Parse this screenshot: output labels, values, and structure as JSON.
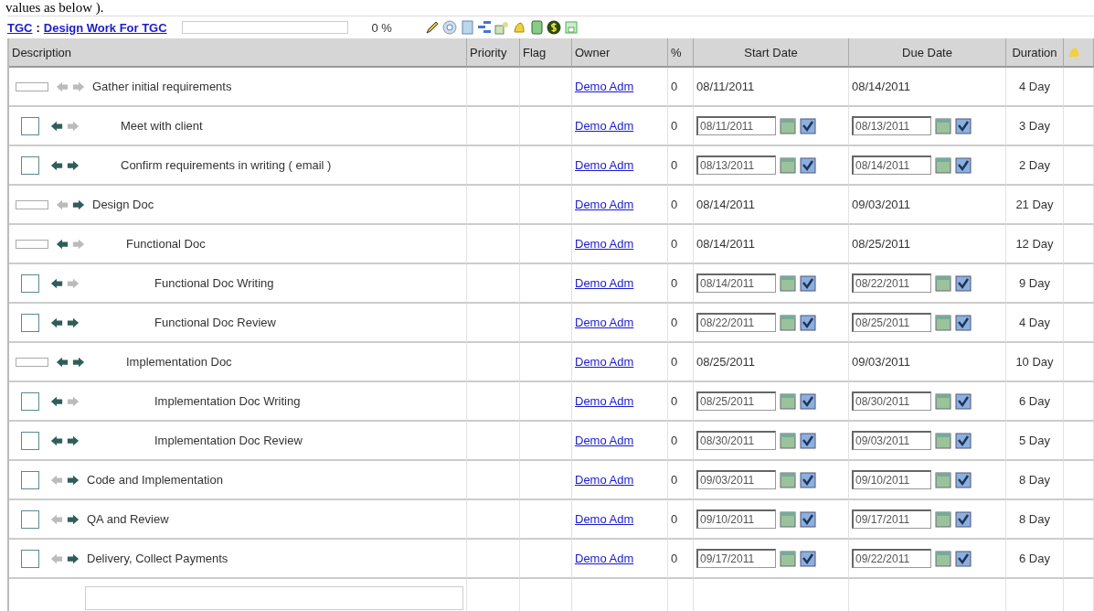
{
  "intro_text": "values as below ).",
  "header": {
    "project_link": "TGC",
    "separator": ":",
    "title_link": "Design Work For TGC",
    "progress": {
      "level": 0
    },
    "percent": "0 %"
  },
  "columns": [
    "Description",
    "Priority",
    "Flag",
    "Owner",
    "%",
    "Start Date",
    "Due Date",
    "Duration"
  ],
  "tasks": [
    {
      "kind": "summary",
      "name": "Gather initial requirements",
      "left_enabled": false,
      "right_enabled": false,
      "owner": "Demo Adm",
      "percent": "0",
      "start": "08/11/2011",
      "due": "08/14/2011",
      "duration": "4 Day",
      "children": [
        {
          "kind": "task",
          "name": "Meet with client",
          "checked": false,
          "left_enabled": true,
          "right_enabled": false,
          "owner": "Demo Adm",
          "percent": "0",
          "start": "08/11/2011",
          "due": "08/13/2011",
          "duration": "3 Day"
        },
        {
          "kind": "task",
          "name": "Confirm requirements in writing ( email )",
          "checked": false,
          "left_enabled": true,
          "right_enabled": true,
          "owner": "Demo Adm",
          "percent": "0",
          "start": "08/13/2011",
          "due": "08/14/2011",
          "duration": "2 Day"
        }
      ]
    },
    {
      "kind": "summary",
      "name": "Design Doc",
      "left_enabled": false,
      "right_enabled": true,
      "owner": "Demo Adm",
      "percent": "0",
      "start": "08/14/2011",
      "due": "09/03/2011",
      "duration": "21 Day",
      "children": [
        {
          "kind": "summary",
          "name": "Functional Doc",
          "left_enabled": true,
          "right_enabled": false,
          "owner": "Demo Adm",
          "percent": "0",
          "start": "08/14/2011",
          "due": "08/25/2011",
          "duration": "12 Day",
          "children": [
            {
              "kind": "task",
              "name": "Functional Doc Writing",
              "checked": false,
              "left_enabled": true,
              "right_enabled": false,
              "owner": "Demo Adm",
              "percent": "0",
              "start": "08/14/2011",
              "due": "08/22/2011",
              "duration": "9 Day"
            },
            {
              "kind": "task",
              "name": "Functional Doc Review",
              "checked": false,
              "left_enabled": true,
              "right_enabled": true,
              "owner": "Demo Adm",
              "percent": "0",
              "start": "08/22/2011",
              "due": "08/25/2011",
              "duration": "4 Day"
            }
          ]
        },
        {
          "kind": "summary",
          "name": "Implementation Doc",
          "left_enabled": true,
          "right_enabled": true,
          "owner": "Demo Adm",
          "percent": "0",
          "start": "08/25/2011",
          "due": "09/03/2011",
          "duration": "10 Day",
          "children": [
            {
              "kind": "task",
              "name": "Implementation Doc Writing",
              "checked": false,
              "left_enabled": true,
              "right_enabled": false,
              "owner": "Demo Adm",
              "percent": "0",
              "start": "08/25/2011",
              "due": "08/30/2011",
              "duration": "6 Day"
            },
            {
              "kind": "task",
              "name": "Implementation Doc Review",
              "checked": false,
              "left_enabled": true,
              "right_enabled": true,
              "owner": "Demo Adm",
              "percent": "0",
              "start": "08/30/2011",
              "due": "09/03/2011",
              "duration": "5 Day"
            }
          ]
        }
      ]
    },
    {
      "kind": "task",
      "name": "Code and Implementation",
      "checked": false,
      "left_enabled": false,
      "right_enabled": true,
      "owner": "Demo Adm",
      "percent": "0",
      "start": "09/03/2011",
      "due": "09/10/2011",
      "duration": "8 Day"
    },
    {
      "kind": "task",
      "name": "QA and Review",
      "checked": false,
      "left_enabled": false,
      "right_enabled": true,
      "owner": "Demo Adm",
      "percent": "0",
      "start": "09/10/2011",
      "due": "09/17/2011",
      "duration": "8 Day"
    },
    {
      "kind": "task",
      "name": "Delivery, Collect Payments",
      "checked": false,
      "left_enabled": false,
      "right_enabled": true,
      "owner": "Demo Adm",
      "percent": "0",
      "start": "09/17/2011",
      "due": "09/22/2011",
      "duration": "6 Day"
    }
  ]
}
